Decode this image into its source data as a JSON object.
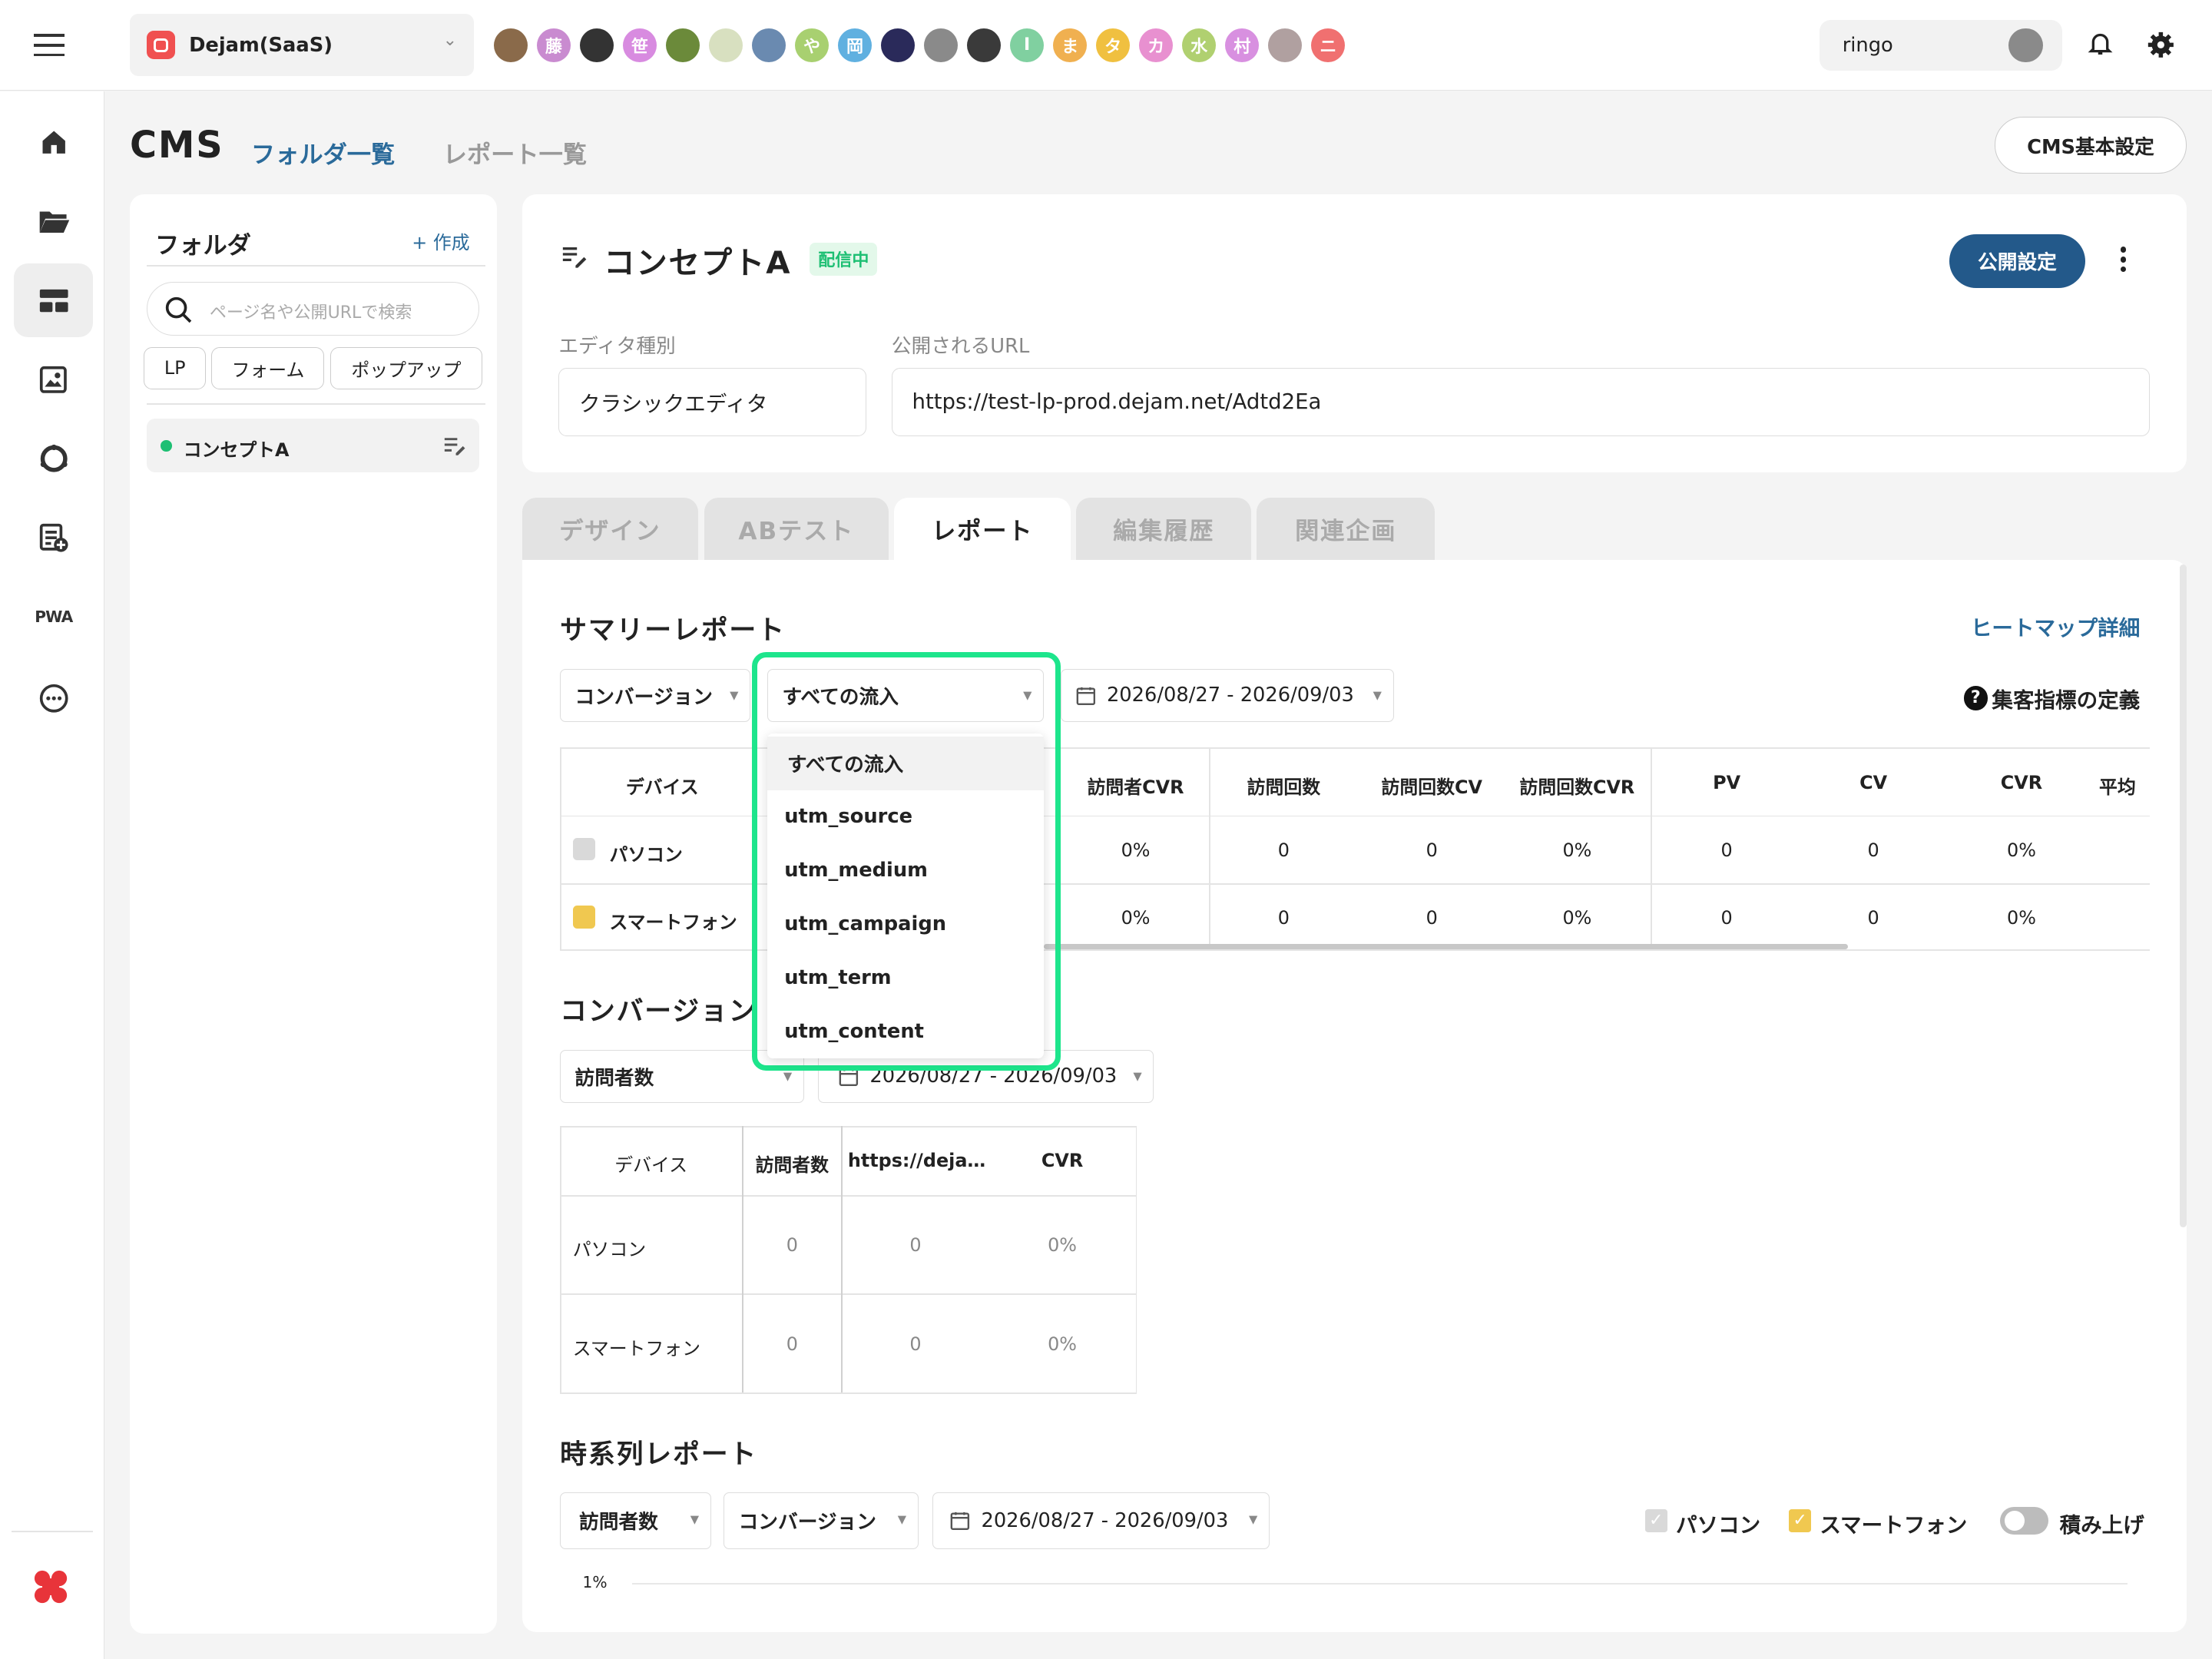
{
  "topbar": {
    "workspace": "Dejam(SaaS)",
    "avatars": [
      {
        "label": "",
        "color": "#8a6a4a"
      },
      {
        "label": "藤",
        "color": "#c98bd0"
      },
      {
        "label": "",
        "color": "#333333"
      },
      {
        "label": "笹",
        "color": "#d88be0"
      },
      {
        "label": "",
        "color": "#6b8a3a"
      },
      {
        "label": "",
        "color": "#d8e0c0"
      },
      {
        "label": "",
        "color": "#6a8ab0"
      },
      {
        "label": "や",
        "color": "#a8d070"
      },
      {
        "label": "岡",
        "color": "#60b0e0"
      },
      {
        "label": "",
        "color": "#2a2a5a"
      },
      {
        "label": "",
        "color": "#8a8a8a"
      },
      {
        "label": "",
        "color": "#3a3a3a"
      },
      {
        "label": "I",
        "color": "#80d0a0"
      },
      {
        "label": "ま",
        "color": "#f0b050"
      },
      {
        "label": "タ",
        "color": "#f0c040"
      },
      {
        "label": "カ",
        "color": "#e890d0"
      },
      {
        "label": "水",
        "color": "#b0d070"
      },
      {
        "label": "村",
        "color": "#d890e0"
      },
      {
        "label": "",
        "color": "#b0a0a0"
      },
      {
        "label": "ニ",
        "color": "#f07070"
      }
    ],
    "user": "ringo"
  },
  "sidenav": {
    "items": [
      "home-icon",
      "folder-icon",
      "layout-icon",
      "image-icon",
      "circle-icon",
      "doc-add-icon",
      "pwa-icon",
      "more-icon"
    ],
    "pwa_label": "PWA"
  },
  "header": {
    "title": "CMS",
    "nav_folders": "フォルダ一覧",
    "nav_reports": "レポート一覧",
    "settings_button": "CMS基本設定"
  },
  "folder_panel": {
    "title": "フォルダ",
    "create": "+ 作成",
    "search_placeholder": "ページ名や公開URLで検索",
    "filters": [
      "LP",
      "フォーム",
      "ポップアップ"
    ],
    "item": "コンセプトA"
  },
  "page_card": {
    "title": "コンセプトA",
    "status": "配信中",
    "publish_button": "公開設定",
    "editor_label": "エディタ種別",
    "editor_value": "クラシックエディタ",
    "url_label": "公開されるURL",
    "url_value": "https://test-lp-prod.dejam.net/Adtd2Ea"
  },
  "tabs": [
    "デザイン",
    "ABテスト",
    "レポート",
    "編集履歴",
    "関連企画"
  ],
  "summary": {
    "title": "サマリーレポート",
    "heatmap_link": "ヒートマップ詳細",
    "metric_select": "コンバージョン",
    "source_select": "すべての流入",
    "date_range": "2026/08/27 - 2026/09/03",
    "definition_link": "集客指標の定義",
    "columns": [
      "デバイス",
      "訪問者CVR",
      "訪問回数",
      "訪問回数CV",
      "訪問回数CVR",
      "PV",
      "CV",
      "CVR",
      "平均"
    ],
    "rows": [
      {
        "device": "パソコン",
        "swatch": "#d9d9d9",
        "values": [
          "0%",
          "0",
          "0",
          "0%",
          "0",
          "0",
          "0%"
        ]
      },
      {
        "device": "スマートフォン",
        "swatch": "#f0c850",
        "values": [
          "0%",
          "0",
          "0",
          "0%",
          "0",
          "0",
          "0%"
        ]
      }
    ]
  },
  "dropdown": {
    "options": [
      "すべての流入",
      "utm_source",
      "utm_medium",
      "utm_campaign",
      "utm_term",
      "utm_content"
    ]
  },
  "conversion": {
    "title": "コンバージョン",
    "metric_select": "訪問者数",
    "date_range": "2026/08/27 - 2026/09/03",
    "columns": [
      "デバイス",
      "訪問者数",
      "https://deja…",
      "CVR"
    ],
    "rows": [
      {
        "device": "パソコン",
        "values": [
          "0",
          "0",
          "0%"
        ]
      },
      {
        "device": "スマートフォン",
        "values": [
          "0",
          "0",
          "0%"
        ]
      }
    ]
  },
  "timeseries": {
    "title": "時系列レポート",
    "metric_select": "訪問者数",
    "conv_select": "コンバージョン",
    "date_range": "2026/08/27 - 2026/09/03",
    "legend_pc": "パソコン",
    "legend_sp": "スマートフォン",
    "stack_label": "積み上げ",
    "y_tick": "1%"
  }
}
